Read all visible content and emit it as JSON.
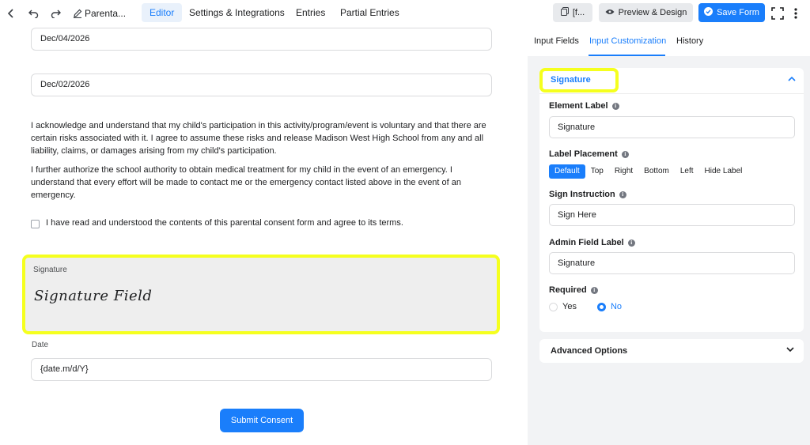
{
  "topbar": {
    "form_title": "Parenta...",
    "tabs": [
      {
        "label": "Editor",
        "active": true
      },
      {
        "label": "Settings & Integrations",
        "active": false
      },
      {
        "label": "Entries",
        "active": false
      },
      {
        "label": "Partial Entries",
        "active": false
      }
    ],
    "shortcode_label": "[f...",
    "preview_label": "Preview & Design",
    "save_label": "Save Form"
  },
  "form": {
    "date_value_1": "Dec/04/2026",
    "date_value_2": "Dec/02/2026",
    "paragraph_1": "I acknowledge and understand that my child's participation in this activity/program/event is voluntary and that there are certain risks associated with it. I agree to assume these risks and release Madison West High School from any and all liability, claims, or damages arising from my child's participation.",
    "paragraph_2": "I further authorize the school authority to obtain medical treatment for my child in the event of an emergency. I understand that every effort will be made to contact me or the emergency contact listed above in the event of an emergency.",
    "terms_label": "I have read and understood the contents of this parental consent form and agree to its terms.",
    "signature_label": "Signature",
    "signature_placeholder": "Signature Field",
    "date_label": "Date",
    "date_placeholder": "{date.m/d/Y}",
    "submit_label": "Submit Consent"
  },
  "sidebar": {
    "tabs": [
      {
        "label": "Input Fields",
        "active": false
      },
      {
        "label": "Input Customization",
        "active": true
      },
      {
        "label": "History",
        "active": false
      }
    ],
    "panel": {
      "title": "Signature",
      "element_label": {
        "label": "Element Label",
        "value": "Signature"
      },
      "label_placement": {
        "label": "Label Placement",
        "options": [
          "Default",
          "Top",
          "Right",
          "Bottom",
          "Left",
          "Hide Label"
        ],
        "selected": "Default"
      },
      "sign_instruction": {
        "label": "Sign Instruction",
        "value": "Sign Here"
      },
      "admin_field_label": {
        "label": "Admin Field Label",
        "value": "Signature"
      },
      "required": {
        "label": "Required",
        "options": [
          "Yes",
          "No"
        ],
        "selected": "No"
      }
    },
    "advanced_options_label": "Advanced Options"
  },
  "colors": {
    "accent": "#1a7efb",
    "highlight": "#f5ff1e",
    "sidebar_bg": "#f2f3f5"
  }
}
